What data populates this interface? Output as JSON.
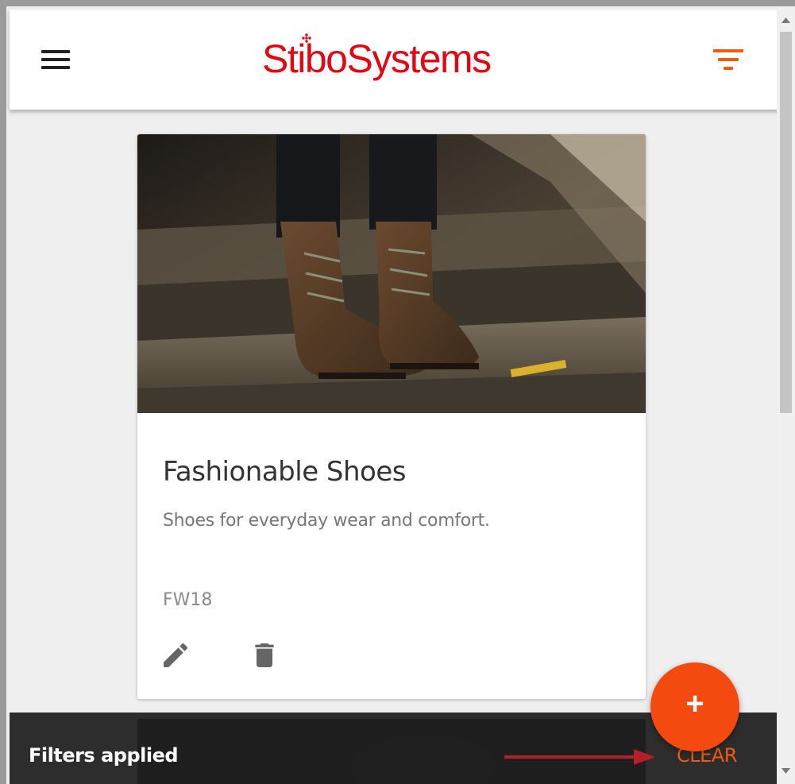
{
  "appbar": {
    "logo_text": "StiboSystems",
    "menu_icon": "menu-icon",
    "filter_icon": "filter-list-icon"
  },
  "card": {
    "image": "boots-on-stairs-photo",
    "title": "Fashionable Shoes",
    "description": "Shoes for everyday wear and comfort.",
    "code": "FW18",
    "actions": [
      {
        "icon": "pencil-icon",
        "label": "Edit"
      },
      {
        "icon": "trash-icon",
        "label": "Delete"
      }
    ]
  },
  "fab": {
    "label": "+",
    "icon": "plus-icon"
  },
  "snackbar": {
    "message": "Filters applied",
    "action_label": "CLEAR"
  },
  "colors": {
    "brand": "#e30613",
    "accent": "#f25a12",
    "fab": "#f44a0f",
    "snackbar": "#1e1e1e",
    "arrow": "#b3202a"
  }
}
